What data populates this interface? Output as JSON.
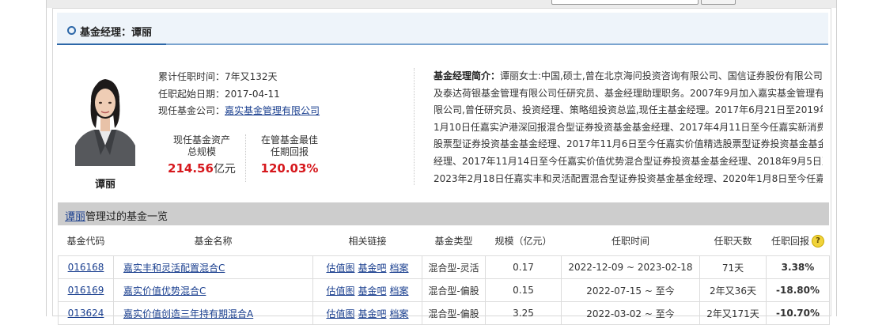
{
  "title": {
    "label": "基金经理：谭丽"
  },
  "manager": {
    "name": "谭丽",
    "tenure_label": "累计任职时间：",
    "tenure_value": "7年又132天",
    "start_label": "任职起始日期：",
    "start_value": "2017-04-11",
    "company_label": "现任基金公司：",
    "company_value": "嘉实基金管理有限公司",
    "assets_label_1": "现任基金资产",
    "assets_label_2": "总规模",
    "assets_value": "214.56",
    "assets_unit": "亿元",
    "best_label_1": "在管基金最佳",
    "best_label_2": "任期回报",
    "best_value": "120.03%"
  },
  "bio": {
    "label": "基金经理简介：",
    "lines": [
      "谭丽女士:中国,硕士,曾在北京海问投资咨询有限公司、国信证券股份有限公司",
      "及泰达荷银基金管理有限公司任研究员、基金经理助理职务。2007年9月加入嘉实基金管理有",
      "限公司,曾任研究员、投资经理、策略组投资总监,现任主基金经理。2017年6月21日至2019年",
      "1月10日任嘉实沪港深回报混合型证券投资基金基金经理、2017年4月11日至今任嘉实新消费",
      "股票型证券投资基金基金经理、2017年11月6日至今任嘉实价值精选股票型证券投资基金基金",
      "经理、2017年11月14日至今任嘉实价值优势混合型证券投资基金基金经理、2018年9月5日至",
      "2023年2月18日任嘉实丰和灵活配置混合型证券投资基金基金经理、2020年1月8日至今任嘉"
    ]
  },
  "fund_list": {
    "manager_link": "谭丽",
    "title_suffix": "管理过的基金一览",
    "headers": {
      "code": "基金代码",
      "name": "基金名称",
      "links": "相关链接",
      "type": "基金类型",
      "size": "规模（亿元）",
      "period": "任职时间",
      "days": "任职天数",
      "return": "任职回报"
    },
    "help_icon": "question-icon",
    "link_labels": {
      "chart": "估值图",
      "forum": "基金吧",
      "archive": "档案"
    },
    "rows": [
      {
        "code": "016168",
        "name": "嘉实丰和灵活配置混合C",
        "type": "混合型-灵活",
        "size": "0.17",
        "period": "2022-12-09 ~ 2023-02-18",
        "days": "71天",
        "return": "3.38%",
        "direction": "pos"
      },
      {
        "code": "016169",
        "name": "嘉实价值优势混合C",
        "type": "混合型-偏股",
        "size": "0.15",
        "period": "2022-07-15 ~ 至今",
        "days": "2年又36天",
        "return": "-18.80%",
        "direction": "neg"
      },
      {
        "code": "013624",
        "name": "嘉实价值创造三年持有期混合A",
        "type": "混合型-偏股",
        "size": "3.25",
        "period": "2022-03-02 ~ 至今",
        "days": "2年又171天",
        "return": "-10.70%",
        "direction": "neg"
      }
    ]
  },
  "colors": {
    "accent": "#2c67a8",
    "positive": "#d6171c",
    "negative": "#1a8a3a",
    "link": "#1a3f8f"
  }
}
